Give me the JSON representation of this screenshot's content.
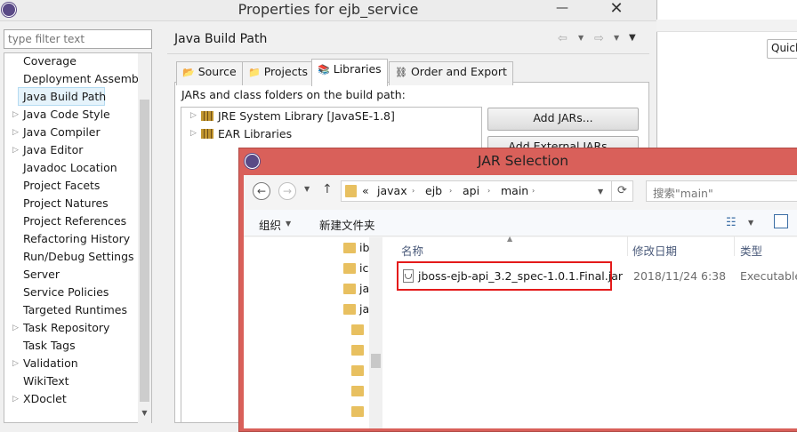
{
  "window": {
    "title": "Properties for ejb_service",
    "minimize_glyph": "—",
    "close_glyph": "✕"
  },
  "quick_access": {
    "placeholder": "Quick"
  },
  "filter": {
    "placeholder": "type filter text"
  },
  "tree": {
    "items": [
      {
        "label": "Coverage",
        "expandable": false
      },
      {
        "label": "Deployment Assembly",
        "expandable": false
      },
      {
        "label": "Java Build Path",
        "expandable": false,
        "selected": true
      },
      {
        "label": "Java Code Style",
        "expandable": true
      },
      {
        "label": "Java Compiler",
        "expandable": true
      },
      {
        "label": "Java Editor",
        "expandable": true
      },
      {
        "label": "Javadoc Location",
        "expandable": false
      },
      {
        "label": "Project Facets",
        "expandable": false
      },
      {
        "label": "Project Natures",
        "expandable": false
      },
      {
        "label": "Project References",
        "expandable": false
      },
      {
        "label": "Refactoring History",
        "expandable": false
      },
      {
        "label": "Run/Debug Settings",
        "expandable": false
      },
      {
        "label": "Server",
        "expandable": false
      },
      {
        "label": "Service Policies",
        "expandable": false
      },
      {
        "label": "Targeted Runtimes",
        "expandable": false
      },
      {
        "label": "Task Repository",
        "expandable": true
      },
      {
        "label": "Task Tags",
        "expandable": false
      },
      {
        "label": "Validation",
        "expandable": true
      },
      {
        "label": "WikiText",
        "expandable": false
      },
      {
        "label": "XDoclet",
        "expandable": true
      }
    ]
  },
  "section": {
    "title": "Java Build Path"
  },
  "tabs": [
    {
      "label": "Source",
      "icon": "source-folder-icon"
    },
    {
      "label": "Projects",
      "icon": "projects-icon"
    },
    {
      "label": "Libraries",
      "icon": "libraries-icon",
      "active": true
    },
    {
      "label": "Order and Export",
      "icon": "order-export-icon"
    }
  ],
  "libraries": {
    "caption": "JARs and class folders on the build path:",
    "entries": [
      "JRE System Library [JavaSE-1.8]",
      "EAR Libraries"
    ],
    "buttons": [
      "Add JARs...",
      "Add External JARs..."
    ]
  },
  "jar_dialog": {
    "title": "JAR Selection",
    "breadcrumb": [
      "«",
      "javax",
      "ejb",
      "api",
      "main"
    ],
    "search_placeholder": "搜索\"main\"",
    "organize_label": "组织",
    "new_folder_label": "新建文件夹",
    "nav_folders": [
      "ib",
      "ic",
      "ja",
      "ja"
    ],
    "columns": [
      "名称",
      "修改日期",
      "类型"
    ],
    "files": [
      {
        "name": "jboss-ejb-api_3.2_spec-1.0.1.Final.jar",
        "modified": "2018/11/24 6:38",
        "type": "Executable"
      }
    ],
    "highlight_color": "#e41a1a"
  },
  "colors": {
    "dialog_title_bar": "#d9605a",
    "selection": "#e5f3fb"
  }
}
